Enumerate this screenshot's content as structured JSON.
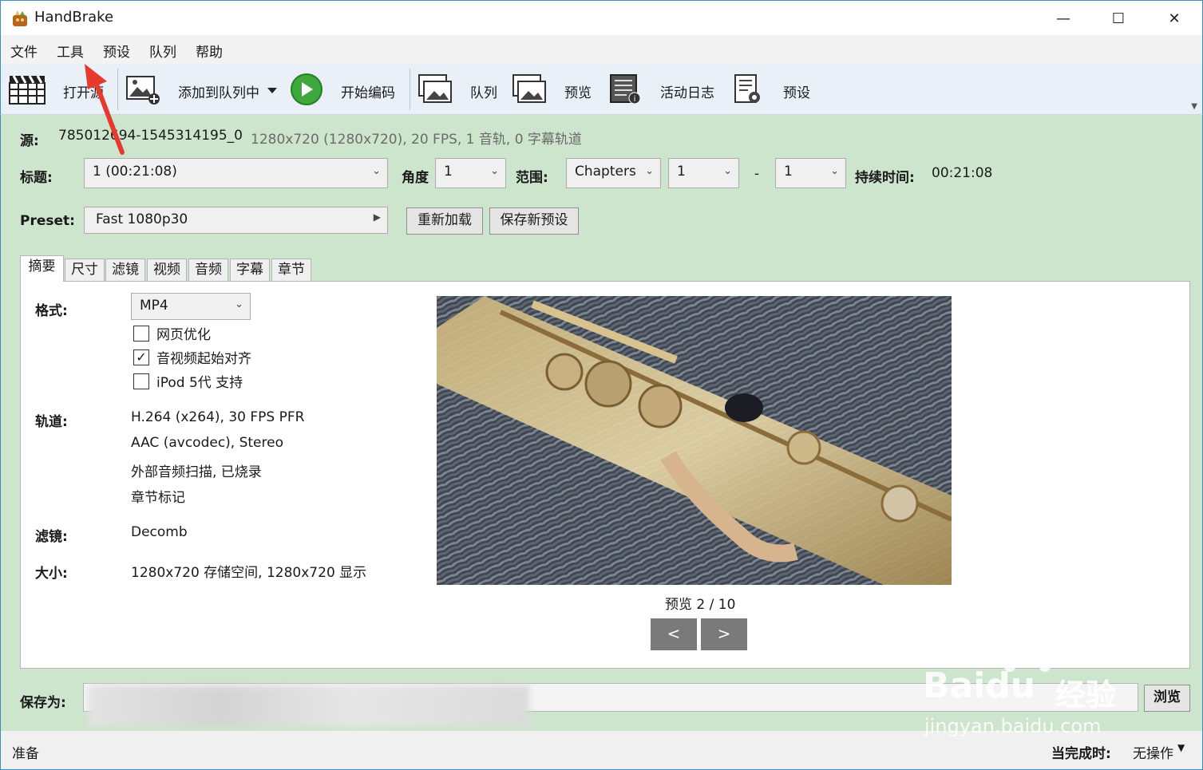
{
  "window": {
    "title": "HandBrake",
    "min_glyph": "—",
    "max_glyph": "☐",
    "close_glyph": "✕"
  },
  "menu": [
    "文件",
    "工具",
    "预设",
    "队列",
    "帮助"
  ],
  "toolbar": {
    "open_label": "打开源",
    "add_queue_label": "添加到队列中",
    "start_label": "开始编码",
    "queue_label": "队列",
    "preview_label": "预览",
    "activity_label": "活动日志",
    "presets_label": "预设"
  },
  "source": {
    "label": "源:",
    "name": "785012694-1545314195_0",
    "info": "1280x720 (1280x720), 20 FPS, 1 音轨, 0 字幕轨道"
  },
  "title_row": {
    "title_label": "标题:",
    "title_value": "1  (00:21:08)",
    "angle_label": "角度",
    "angle_value": "1",
    "range_label": "范围:",
    "range_type": "Chapters",
    "range_start": "1",
    "range_dash": "-",
    "range_end": "1",
    "duration_label": "持续时间:",
    "duration_value": "00:21:08"
  },
  "preset_row": {
    "label": "Preset:",
    "value": "Fast 1080p30",
    "reload_label": "重新加载",
    "save_new_label": "保存新预设"
  },
  "tabs": [
    "摘要",
    "尺寸",
    "滤镜",
    "视频",
    "音频",
    "字幕",
    "章节"
  ],
  "summary": {
    "format_label": "格式:",
    "format_value": "MP4",
    "web_optimize_label": "网页优化",
    "align_av_label": "音视频起始对齐",
    "ipod_label": "iPod 5代 支持",
    "check_mark": "✓",
    "tracks_label": "轨道:",
    "tracks": [
      "H.264 (x264), 30 FPS PFR",
      "AAC (avcodec), Stereo",
      "外部音频扫描, 已烧录",
      "章节标记"
    ],
    "filters_label": "滤镜:",
    "filters_value": "Decomb",
    "size_label": "大小:",
    "size_value": "1280x720 存储空间, 1280x720 显示",
    "preview_caption": "预览 2 / 10",
    "prev_label": "<",
    "next_label": ">"
  },
  "save": {
    "label": "保存为:",
    "browse_label": "浏览"
  },
  "status": {
    "left": "准备",
    "when_done_label": "当完成时:",
    "when_done_value": "无操作"
  },
  "watermark": {
    "brand": "Baidu",
    "suffix": "经验",
    "url": "jingyan.baidu.com"
  }
}
